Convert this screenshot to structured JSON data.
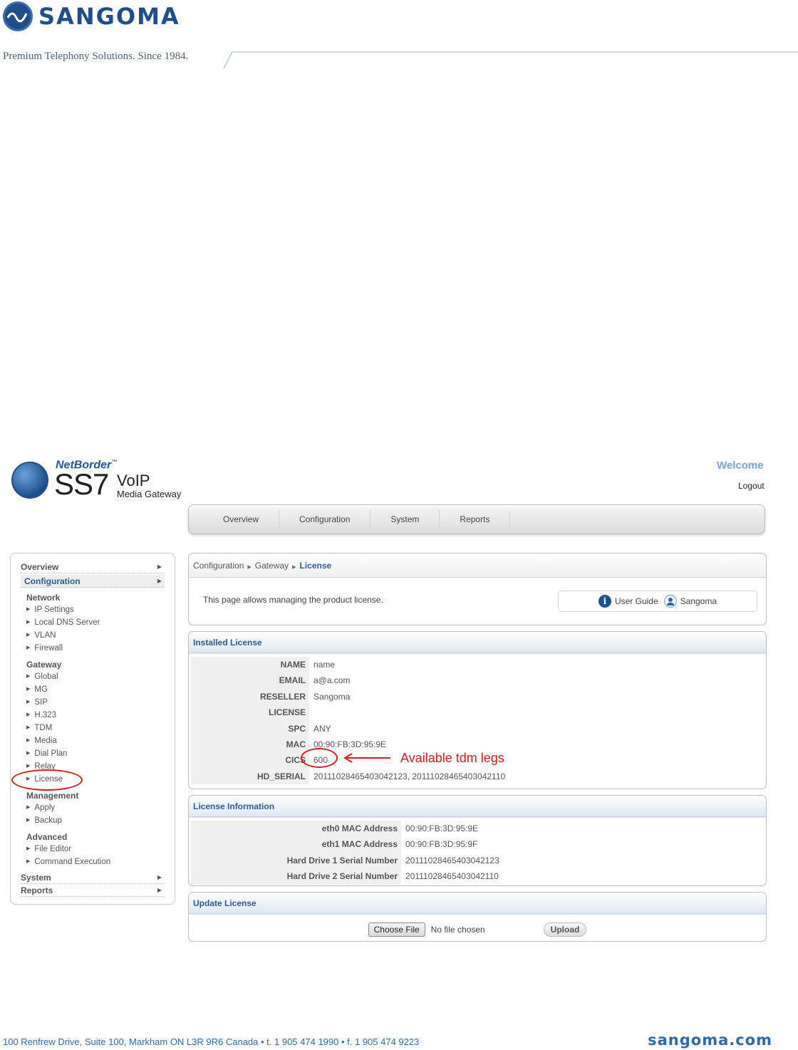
{
  "document": {
    "brand": "SANGOMA",
    "tagline": "Premium Telephony Solutions. Since 1984.",
    "footer_address": "100 Renfrew Drive, Suite 100, Markham ON L3R 9R6 Canada  •  t. 1 905 474 1990  •  f. 1 905 474 9223",
    "footer_domain": "sangoma.com"
  },
  "app": {
    "brand_small": "NetBorder",
    "brand_tm": "™",
    "product_big": "SS7",
    "product_voip": "VoIP",
    "product_sub": "Media Gateway",
    "welcome": "Welcome",
    "logout": "Logout"
  },
  "topnav": {
    "tabs": [
      "Overview",
      "Configuration",
      "System",
      "Reports"
    ]
  },
  "sidebar": {
    "overview": "Overview",
    "configuration": "Configuration",
    "groups": {
      "network": {
        "label": "Network",
        "items": [
          "IP Settings",
          "Local DNS Server",
          "VLAN",
          "Firewall"
        ]
      },
      "gateway": {
        "label": "Gateway",
        "items": [
          "Global",
          "MG",
          "SIP",
          "H.323",
          "TDM",
          "Media",
          "Dial Plan",
          "Relay",
          "License"
        ]
      },
      "management": {
        "label": "Management",
        "items": [
          "Apply",
          "Backup"
        ]
      },
      "advanced": {
        "label": "Advanced",
        "items": [
          "File Editor",
          "Command Execution"
        ]
      }
    },
    "system": "System",
    "reports": "Reports"
  },
  "breadcrumb": {
    "items": [
      "Configuration",
      "Gateway"
    ],
    "current": "License"
  },
  "page_description": "This page allows managing the product license.",
  "help": {
    "user_guide": "User Guide",
    "sangoma": "Sangoma"
  },
  "installed_license": {
    "title": "Installed License",
    "rows": [
      {
        "key": "NAME",
        "value": "name"
      },
      {
        "key": "EMAIL",
        "value": "a@a.com"
      },
      {
        "key": "RESELLER",
        "value": "Sangoma"
      },
      {
        "key": "LICENSE",
        "value": ""
      },
      {
        "key": "SPC",
        "value": "ANY"
      },
      {
        "key": "MAC",
        "value": "00:90:FB:3D:95:9E"
      },
      {
        "key": "CICS",
        "value": "600"
      },
      {
        "key": "HD_SERIAL",
        "value": "20111028465403042123, 20111028465403042110"
      }
    ]
  },
  "annotation": {
    "text": "Available tdm legs",
    "color": "#e21b1b"
  },
  "license_information": {
    "title": "License Information",
    "rows": [
      {
        "key": "eth0 MAC Address",
        "value": "00:90:FB:3D:95:9E"
      },
      {
        "key": "eth1 MAC Address",
        "value": "00:90:FB:3D:95:9F"
      },
      {
        "key": "Hard Drive 1 Serial Number",
        "value": "20111028465403042123"
      },
      {
        "key": "Hard Drive 2 Serial Number",
        "value": "20111028465403042110"
      }
    ]
  },
  "update_license": {
    "title": "Update License",
    "choose_file": "Choose File",
    "no_file": "No file chosen",
    "upload": "Upload"
  }
}
